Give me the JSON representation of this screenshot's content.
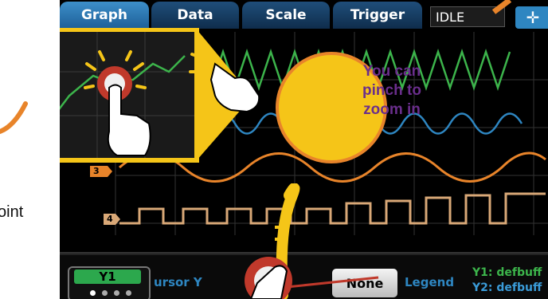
{
  "tabs": [
    {
      "label": "Graph",
      "active": true
    },
    {
      "label": "Data",
      "active": false
    },
    {
      "label": "Scale",
      "active": false
    },
    {
      "label": "Trigger",
      "active": false
    }
  ],
  "status": {
    "text": "IDLE"
  },
  "channels": [
    {
      "label": "3",
      "color": "#e8842a"
    },
    {
      "label": "4",
      "color": "#d9a877"
    }
  ],
  "callout": {
    "text": "You can pinch to zoom in",
    "lines": [
      "You can",
      "pinch to",
      "zoom in"
    ]
  },
  "bottom": {
    "y1_label": "Y1",
    "cursor_text": "ursor  Y",
    "none_button": "None",
    "legend_label": "Legend",
    "y1_buffer": "Y1: defbuff",
    "y2_buffer": "Y2: defbuff"
  },
  "page_text": {
    "point": "oint"
  },
  "colors": {
    "trace_green": "#3cb44b",
    "trace_blue": "#2e86c1",
    "trace_orange": "#e8842a",
    "trace_tan": "#d9a877",
    "callout_yellow": "#f5c518",
    "callout_text": "#6a2e8c",
    "tap_red": "#c0392b"
  }
}
